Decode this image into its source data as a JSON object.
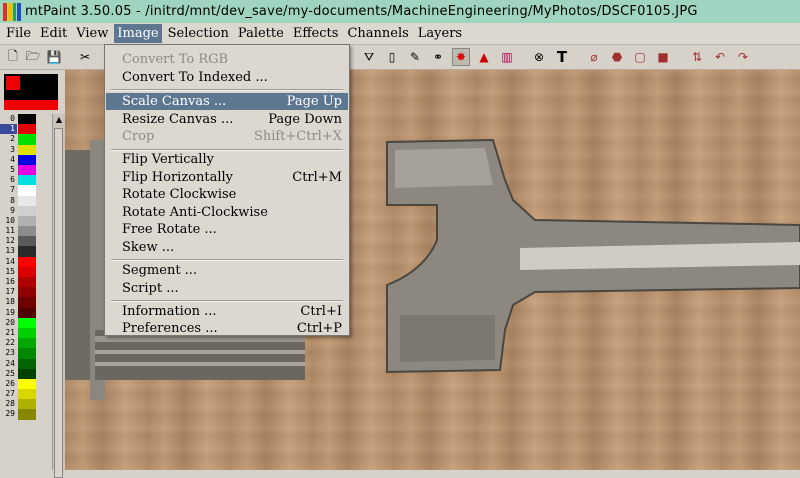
{
  "window": {
    "title": "mtPaint 3.50.05 - /initrd/mnt/dev_save/my-documents/MachineEngineering/MyPhotos/DSCF0105.JPG"
  },
  "menubar": [
    "File",
    "Edit",
    "View",
    "Image",
    "Selection",
    "Palette",
    "Effects",
    "Channels",
    "Layers"
  ],
  "image_menu": {
    "items": [
      {
        "label": "Convert To RGB",
        "shortcut": "",
        "state": "disabled"
      },
      {
        "label": "Convert To Indexed ...",
        "shortcut": "",
        "state": "normal"
      },
      {
        "label": "Scale Canvas ...",
        "shortcut": "Page Up",
        "state": "highlighted"
      },
      {
        "label": "Resize Canvas ...",
        "shortcut": "Page Down",
        "state": "normal"
      },
      {
        "label": "Crop",
        "shortcut": "Shift+Ctrl+X",
        "state": "disabled"
      },
      {
        "label": "Flip Vertically",
        "shortcut": "",
        "state": "normal"
      },
      {
        "label": "Flip Horizontally",
        "shortcut": "Ctrl+M",
        "state": "normal"
      },
      {
        "label": "Rotate Clockwise",
        "shortcut": "",
        "state": "normal"
      },
      {
        "label": "Rotate Anti-Clockwise",
        "shortcut": "",
        "state": "normal"
      },
      {
        "label": "Free Rotate ...",
        "shortcut": "",
        "state": "normal"
      },
      {
        "label": "Skew ...",
        "shortcut": "",
        "state": "normal"
      },
      {
        "label": "Segment ...",
        "shortcut": "",
        "state": "normal"
      },
      {
        "label": "Script ...",
        "shortcut": "",
        "state": "normal"
      },
      {
        "label": "Information ...",
        "shortcut": "Ctrl+I",
        "state": "normal"
      },
      {
        "label": "Preferences ...",
        "shortcut": "Ctrl+P",
        "state": "normal"
      }
    ]
  },
  "palette": {
    "numbers": [
      "0",
      "1",
      "2",
      "3",
      "4",
      "5",
      "6",
      "7",
      "8",
      "9",
      "10",
      "11",
      "12",
      "13",
      "14",
      "15",
      "16",
      "17",
      "18",
      "19",
      "20",
      "21",
      "22",
      "23",
      "24",
      "25",
      "26",
      "27",
      "28",
      "29"
    ],
    "colors": [
      "#000000",
      "#e00000",
      "#00e000",
      "#e0e000",
      "#0000e0",
      "#e000e0",
      "#00e0e0",
      "#ffffff",
      "#e8e8e8",
      "#cfcfcf",
      "#b0b0b0",
      "#8c8c8c",
      "#5a5a5a",
      "#2a2a2a",
      "#ff0000",
      "#d80000",
      "#b00000",
      "#900000",
      "#700000",
      "#500000",
      "#00ff00",
      "#00d000",
      "#00a800",
      "#008800",
      "#006400",
      "#004000",
      "#ffff00",
      "#d8d800",
      "#b0b000",
      "#888800"
    ]
  },
  "toolbar_icons": [
    "new-icon",
    "open-icon",
    "save-icon",
    "cut-icon",
    "fill-icon",
    "line-icon",
    "smudge-icon",
    "clone-icon",
    "select-rect-icon",
    "paint-icon",
    "gradient-icon",
    "pattern-icon",
    "text-icon",
    "lasso-icon",
    "polygon-icon",
    "rect-icon",
    "ellipse-icon",
    "flip-icon",
    "undo-icon",
    "redo-icon"
  ],
  "toolbar_glyphs": [
    "🗋",
    "🗁",
    "💾",
    "✂",
    "⛛",
    "▯",
    "✎",
    "⚭",
    "✸",
    "▲",
    "▥",
    "⊗",
    "T",
    "⌀",
    "⬣",
    "▢",
    "■",
    "⇅",
    "↶",
    "↷"
  ]
}
